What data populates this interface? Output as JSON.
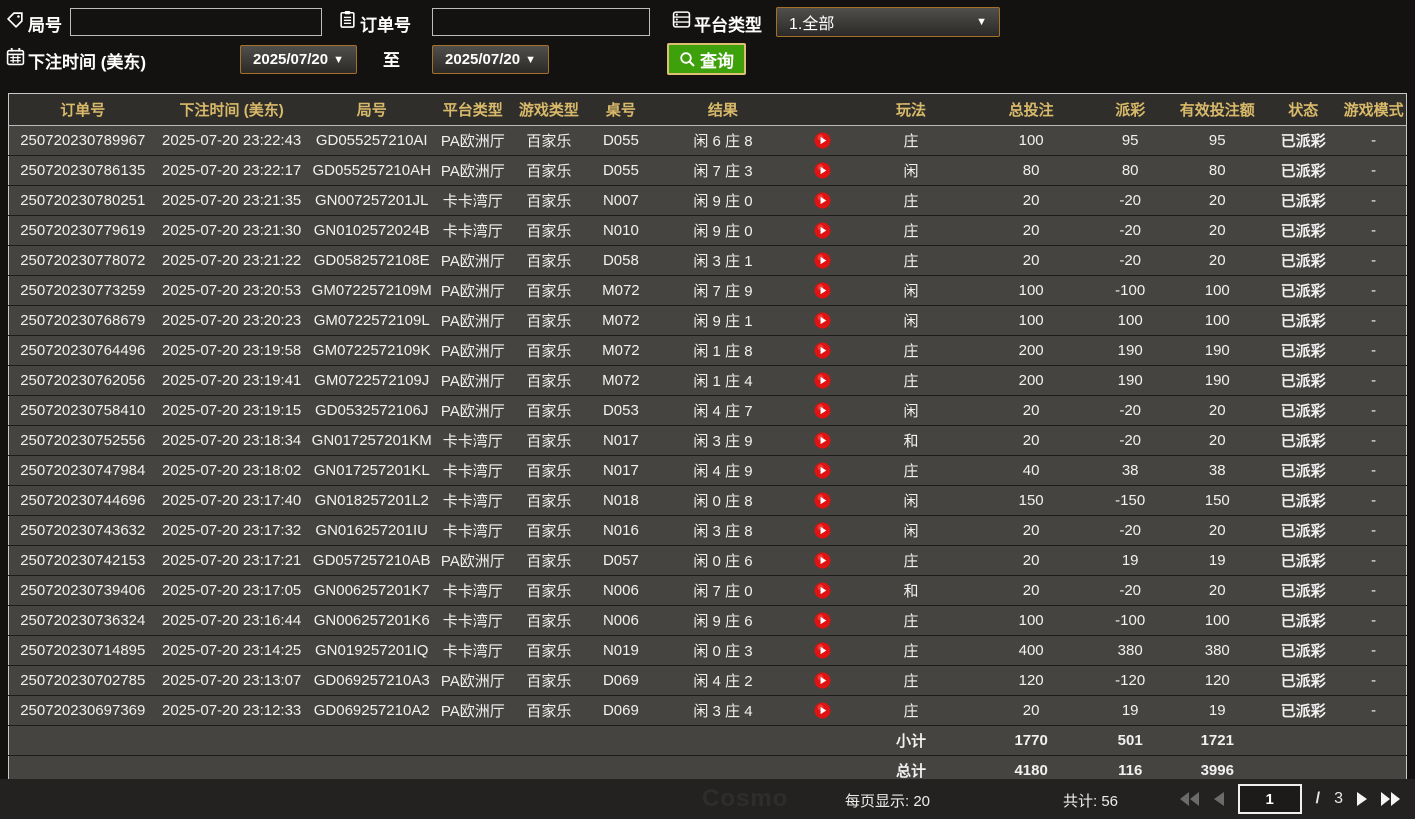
{
  "filters": {
    "game_no": {
      "label": "局号",
      "value": ""
    },
    "order_no": {
      "label": "订单号",
      "value": ""
    },
    "platform": {
      "label": "平台类型",
      "value": "1.全部"
    },
    "bet_time": {
      "label": "下注时间 (美东)",
      "from": "2025/07/20",
      "to_label": "至",
      "to": "2025/07/20"
    },
    "search_label": "查询"
  },
  "ui": {
    "caret": "▼"
  },
  "colors": {
    "accent_green": "#3ea00a",
    "header_gold": "#d9ba6a",
    "payout_positive": "#c12742",
    "payout_negative": "#8bdc27",
    "status_green": "#35e53a",
    "summary_yellow": "#eaea1c",
    "date_border_orange": "#a5702a"
  },
  "table": {
    "headers": [
      "订单号",
      "下注时间 (美东)",
      "局号",
      "平台类型",
      "游戏类型",
      "桌号",
      "结果",
      "",
      "玩法",
      "总投注",
      "派彩",
      "有效投注额",
      "状态",
      "游戏模式"
    ],
    "rows": [
      {
        "order": "250720230789967",
        "time": "2025-07-20 23:22:43",
        "game": "GD055257210AI",
        "platform": "PA欧洲厅",
        "game_type": "百家乐",
        "table": "D055",
        "result": "闲 6 庄 8",
        "bet_type": "庄",
        "total_bet": "100",
        "payout": "95",
        "valid_bet": "95",
        "status": "已派彩",
        "mode": "-"
      },
      {
        "order": "250720230786135",
        "time": "2025-07-20 23:22:17",
        "game": "GD055257210AH",
        "platform": "PA欧洲厅",
        "game_type": "百家乐",
        "table": "D055",
        "result": "闲 7 庄 3",
        "bet_type": "闲",
        "total_bet": "80",
        "payout": "80",
        "valid_bet": "80",
        "status": "已派彩",
        "mode": "-"
      },
      {
        "order": "250720230780251",
        "time": "2025-07-20 23:21:35",
        "game": "GN007257201JL",
        "platform": "卡卡湾厅",
        "game_type": "百家乐",
        "table": "N007",
        "result": "闲 9 庄 0",
        "bet_type": "庄",
        "total_bet": "20",
        "payout": "-20",
        "valid_bet": "20",
        "status": "已派彩",
        "mode": "-"
      },
      {
        "order": "250720230779619",
        "time": "2025-07-20 23:21:30",
        "game": "GN0102572024B",
        "platform": "卡卡湾厅",
        "game_type": "百家乐",
        "table": "N010",
        "result": "闲 9 庄 0",
        "bet_type": "庄",
        "total_bet": "20",
        "payout": "-20",
        "valid_bet": "20",
        "status": "已派彩",
        "mode": "-"
      },
      {
        "order": "250720230778072",
        "time": "2025-07-20 23:21:22",
        "game": "GD0582572108E",
        "platform": "PA欧洲厅",
        "game_type": "百家乐",
        "table": "D058",
        "result": "闲 3 庄 1",
        "bet_type": "庄",
        "total_bet": "20",
        "payout": "-20",
        "valid_bet": "20",
        "status": "已派彩",
        "mode": "-"
      },
      {
        "order": "250720230773259",
        "time": "2025-07-20 23:20:53",
        "game": "GM0722572109M",
        "platform": "PA欧洲厅",
        "game_type": "百家乐",
        "table": "M072",
        "result": "闲 7 庄 9",
        "bet_type": "闲",
        "total_bet": "100",
        "payout": "-100",
        "valid_bet": "100",
        "status": "已派彩",
        "mode": "-"
      },
      {
        "order": "250720230768679",
        "time": "2025-07-20 23:20:23",
        "game": "GM0722572109L",
        "platform": "PA欧洲厅",
        "game_type": "百家乐",
        "table": "M072",
        "result": "闲 9 庄 1",
        "bet_type": "闲",
        "total_bet": "100",
        "payout": "100",
        "valid_bet": "100",
        "status": "已派彩",
        "mode": "-"
      },
      {
        "order": "250720230764496",
        "time": "2025-07-20 23:19:58",
        "game": "GM0722572109K",
        "platform": "PA欧洲厅",
        "game_type": "百家乐",
        "table": "M072",
        "result": "闲 1 庄 8",
        "bet_type": "庄",
        "total_bet": "200",
        "payout": "190",
        "valid_bet": "190",
        "status": "已派彩",
        "mode": "-"
      },
      {
        "order": "250720230762056",
        "time": "2025-07-20 23:19:41",
        "game": "GM0722572109J",
        "platform": "PA欧洲厅",
        "game_type": "百家乐",
        "table": "M072",
        "result": "闲 1 庄 4",
        "bet_type": "庄",
        "total_bet": "200",
        "payout": "190",
        "valid_bet": "190",
        "status": "已派彩",
        "mode": "-"
      },
      {
        "order": "250720230758410",
        "time": "2025-07-20 23:19:15",
        "game": "GD0532572106J",
        "platform": "PA欧洲厅",
        "game_type": "百家乐",
        "table": "D053",
        "result": "闲 4 庄 7",
        "bet_type": "闲",
        "total_bet": "20",
        "payout": "-20",
        "valid_bet": "20",
        "status": "已派彩",
        "mode": "-"
      },
      {
        "order": "250720230752556",
        "time": "2025-07-20 23:18:34",
        "game": "GN017257201KM",
        "platform": "卡卡湾厅",
        "game_type": "百家乐",
        "table": "N017",
        "result": "闲 3 庄 9",
        "bet_type": "和",
        "total_bet": "20",
        "payout": "-20",
        "valid_bet": "20",
        "status": "已派彩",
        "mode": "-"
      },
      {
        "order": "250720230747984",
        "time": "2025-07-20 23:18:02",
        "game": "GN017257201KL",
        "platform": "卡卡湾厅",
        "game_type": "百家乐",
        "table": "N017",
        "result": "闲 4 庄 9",
        "bet_type": "庄",
        "total_bet": "40",
        "payout": "38",
        "valid_bet": "38",
        "status": "已派彩",
        "mode": "-"
      },
      {
        "order": "250720230744696",
        "time": "2025-07-20 23:17:40",
        "game": "GN018257201L2",
        "platform": "卡卡湾厅",
        "game_type": "百家乐",
        "table": "N018",
        "result": "闲 0 庄 8",
        "bet_type": "闲",
        "total_bet": "150",
        "payout": "-150",
        "valid_bet": "150",
        "status": "已派彩",
        "mode": "-"
      },
      {
        "order": "250720230743632",
        "time": "2025-07-20 23:17:32",
        "game": "GN016257201IU",
        "platform": "卡卡湾厅",
        "game_type": "百家乐",
        "table": "N016",
        "result": "闲 3 庄 8",
        "bet_type": "闲",
        "total_bet": "20",
        "payout": "-20",
        "valid_bet": "20",
        "status": "已派彩",
        "mode": "-"
      },
      {
        "order": "250720230742153",
        "time": "2025-07-20 23:17:21",
        "game": "GD057257210AB",
        "platform": "PA欧洲厅",
        "game_type": "百家乐",
        "table": "D057",
        "result": "闲 0 庄 6",
        "bet_type": "庄",
        "total_bet": "20",
        "payout": "19",
        "valid_bet": "19",
        "status": "已派彩",
        "mode": "-"
      },
      {
        "order": "250720230739406",
        "time": "2025-07-20 23:17:05",
        "game": "GN006257201K7",
        "platform": "卡卡湾厅",
        "game_type": "百家乐",
        "table": "N006",
        "result": "闲 7 庄 0",
        "bet_type": "和",
        "total_bet": "20",
        "payout": "-20",
        "valid_bet": "20",
        "status": "已派彩",
        "mode": "-"
      },
      {
        "order": "250720230736324",
        "time": "2025-07-20 23:16:44",
        "game": "GN006257201K6",
        "platform": "卡卡湾厅",
        "game_type": "百家乐",
        "table": "N006",
        "result": "闲 9 庄 6",
        "bet_type": "庄",
        "total_bet": "100",
        "payout": "-100",
        "valid_bet": "100",
        "status": "已派彩",
        "mode": "-"
      },
      {
        "order": "250720230714895",
        "time": "2025-07-20 23:14:25",
        "game": "GN019257201IQ",
        "platform": "卡卡湾厅",
        "game_type": "百家乐",
        "table": "N019",
        "result": "闲 0 庄 3",
        "bet_type": "庄",
        "total_bet": "400",
        "payout": "380",
        "valid_bet": "380",
        "status": "已派彩",
        "mode": "-"
      },
      {
        "order": "250720230702785",
        "time": "2025-07-20 23:13:07",
        "game": "GD069257210A3",
        "platform": "PA欧洲厅",
        "game_type": "百家乐",
        "table": "D069",
        "result": "闲 4 庄 2",
        "bet_type": "庄",
        "total_bet": "120",
        "payout": "-120",
        "valid_bet": "120",
        "status": "已派彩",
        "mode": "-"
      },
      {
        "order": "250720230697369",
        "time": "2025-07-20 23:12:33",
        "game": "GD069257210A2",
        "platform": "PA欧洲厅",
        "game_type": "百家乐",
        "table": "D069",
        "result": "闲 3 庄 4",
        "bet_type": "庄",
        "total_bet": "20",
        "payout": "19",
        "valid_bet": "19",
        "status": "已派彩",
        "mode": "-"
      }
    ],
    "subtotal": {
      "label": "小计",
      "total_bet": "1770",
      "payout": "501",
      "valid_bet": "1721"
    },
    "total": {
      "label": "总计",
      "total_bet": "4180",
      "payout": "116",
      "valid_bet": "3996"
    }
  },
  "footer": {
    "per_page_label": "每页显示:",
    "per_page": "20",
    "total_label": "共计:",
    "total": "56",
    "page": "1",
    "page_sep": "/",
    "pages": "3",
    "watermark": "Cosmo"
  }
}
